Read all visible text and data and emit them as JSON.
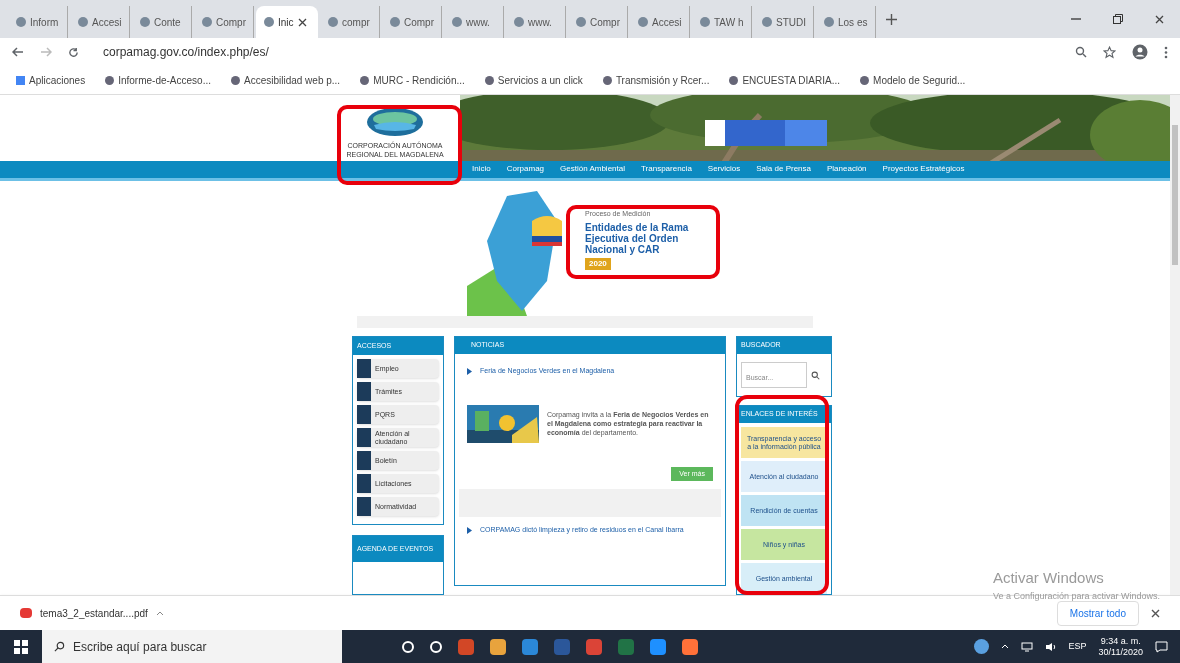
{
  "tabs": [
    {
      "label": "Inform",
      "selected": false
    },
    {
      "label": "Accesi",
      "selected": false
    },
    {
      "label": "Conte",
      "selected": false
    },
    {
      "label": "Compr",
      "selected": false
    },
    {
      "label": "Inic",
      "selected": true
    },
    {
      "label": "compr",
      "selected": false
    },
    {
      "label": "Compr",
      "selected": false
    },
    {
      "label": "www.",
      "selected": false
    },
    {
      "label": "www.",
      "selected": false
    },
    {
      "label": "Compr",
      "selected": false
    },
    {
      "label": "Accesi",
      "selected": false
    },
    {
      "label": "TAW h",
      "selected": false
    },
    {
      "label": "STUDI",
      "selected": false
    },
    {
      "label": "Los es",
      "selected": false
    }
  ],
  "address": "corpamag.gov.co/index.php/es/",
  "bookmarks": [
    "Aplicaciones",
    "Informe-de-Acceso...",
    "Accesibilidad web p...",
    "MURC - Rendición...",
    "Servicios a un click",
    "Transmisión y Rcer...",
    "ENCUESTA DIARIA...",
    "Modelo de Segurid..."
  ],
  "page": {
    "logo_text": "CORPORACIÓN AUTÓNOMA REGIONAL DEL MAGDALENA",
    "nav": [
      "Inicio",
      "Corpamag",
      "Gestión Ambiental",
      "Transparencia",
      "Servicios",
      "Sala de Prensa",
      "Planeación",
      "Proyectos Estratégicos"
    ],
    "banner": {
      "kicker": "Proceso de Medición",
      "title": "Entidades de la Rama Ejecutiva del Orden Nacional y CAR",
      "year": "2020"
    },
    "accesos": {
      "title": "ACCESOS",
      "items": [
        "Empleo",
        "Trámites",
        "PQRS",
        "Atención al ciudadano",
        "Boletín",
        "Licitaciones",
        "Normatividad"
      ]
    },
    "agenda": {
      "title": "AGENDA DE EVENTOS"
    },
    "news": {
      "title": "NOTICIAS",
      "items": [
        {
          "title": "Feria de Negocios Verdes en el Magdalena",
          "lead": "Corpamag invita a la **Feria de Negocios Verdes en el Magdalena como estrategia para reactivar la economía** del departamento.",
          "more": "Ver más"
        },
        {
          "title": "CORPAMAG dictó limpieza y retiro de residuos en el Canal Ibarra"
        }
      ]
    },
    "search": {
      "title": "BUSCADOR",
      "placeholder": "Buscar..."
    },
    "links": {
      "title": "ENLACES DE INTERÉS",
      "items": [
        "Transparencia y acceso a la información pública",
        "Atención al ciudadano",
        "Rendición de cuentas",
        "Niños y niñas",
        "Gestión ambiental"
      ]
    }
  },
  "activate_windows": {
    "title": "Activar Windows",
    "hint": "Ve a Configuración para activar Windows."
  },
  "download": {
    "file": "tema3_2_estandar....pdf",
    "show_all": "Mostrar todo"
  },
  "taskbar": {
    "search_placeholder": "Escribe aquí para buscar",
    "language": "ESP",
    "time": "9:34 a. m.",
    "date": "30/11/2020"
  }
}
